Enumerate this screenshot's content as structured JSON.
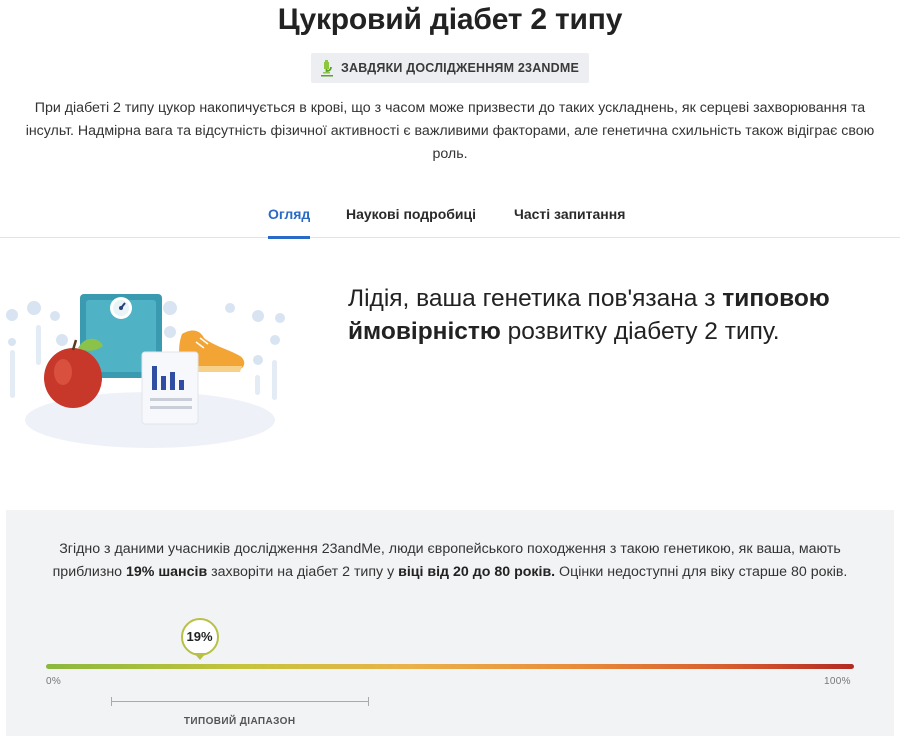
{
  "header": {
    "title": "Цукровий діабет 2 типу",
    "badge": {
      "icon": "microscope-icon",
      "label": "ЗАВДЯКИ ДОСЛІДЖЕННЯМ 23ANDME"
    },
    "intro": "При діабеті 2 типу цукор накопичується в крові, що з часом може призвести до таких ускладнень, як серцеві захворювання та інсульт. Надмірна вага та відсутність фізичної активності є важливими факторами, але генетична схильність також відіграє свою роль."
  },
  "tabs": [
    {
      "label": "Огляд",
      "active": true
    },
    {
      "label": "Наукові подробиці",
      "active": false
    },
    {
      "label": "Часті запитання",
      "active": false
    }
  ],
  "hero": {
    "illustration": "scale-apple-sneaker-chart-illustration",
    "headline_prefix": "Лідія, ваша генетика пов'язана з ",
    "headline_bold": "типовою ймовірністю",
    "headline_suffix": " розвитку діабету 2 типу."
  },
  "estimate": {
    "text_1": "Згідно з даними учасників дослідження 23andMe, люди європейського походження з такою генетикою, як ваша, мають приблизно ",
    "bold_1": "19% шансів",
    "text_2": " захворіти на діабет 2 типу у ",
    "bold_2": "віці від 20 до 80 років.",
    "text_3": " Оцінки недоступні для віку старше 80 років.",
    "marker_label": "19%",
    "marker_value": 0.19,
    "scale_min_label": "0%",
    "scale_max_label": "100%",
    "typical_range": [
      0.08,
      0.4
    ],
    "typical_range_label": "ТИПОВИЙ ДІАПАЗОН"
  },
  "colors": {
    "accent": "#2a6ac7",
    "gauge_start": "#8ab83e",
    "gauge_end": "#b22a22",
    "marker_border": "#b8c045",
    "panel_bg": "#f2f3f5"
  }
}
